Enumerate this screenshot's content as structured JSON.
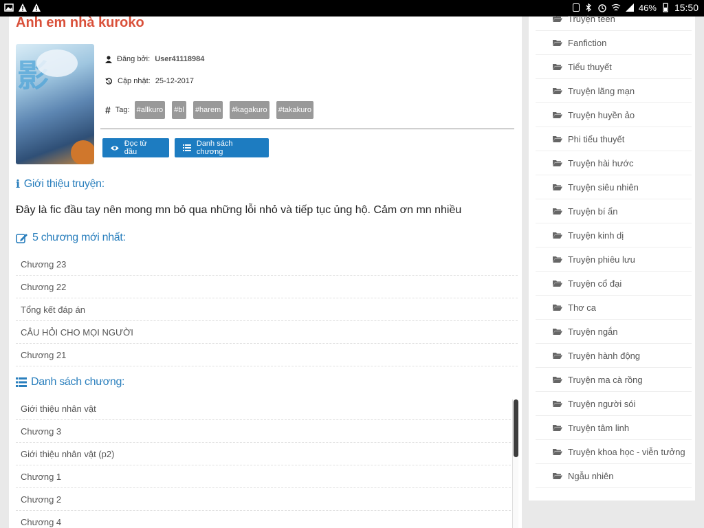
{
  "status": {
    "battery": "46%",
    "time": "15:50"
  },
  "story": {
    "title": "Anh em nhà kuroko",
    "author_label": "Đăng bởi:",
    "author": "User41118984",
    "updated_label": "Cập nhật:",
    "updated": "25-12-2017",
    "tag_label": "Tag:",
    "tags": [
      "#allkuro",
      "#bl",
      "#harem",
      "#kagakuro",
      "#takakuro"
    ]
  },
  "buttons": {
    "read": "Đọc từ đầu",
    "list": "Danh sách chương"
  },
  "sections": {
    "intro_title": "Giới thiệu truyện:",
    "intro_text": "Đây là fic đầu tay nên mong mn bỏ qua những lỗi nhỏ và tiếp tục ủng hộ. Cảm ơn mn nhiều",
    "latest_title": "5 chương mới nhất:",
    "list_title": "Danh sách chương:"
  },
  "latest_chapters": [
    "Chương 23",
    "Chương 22",
    "Tổng kết đáp án",
    "CÂU HỎI CHO MỌI NGƯỜI",
    "Chương 21"
  ],
  "all_chapters": [
    "Giới thiệu nhân vật",
    "Chương 3",
    "Giới thiệu nhân vật (p2)",
    "Chương 1",
    "Chương 2",
    "Chương 4"
  ],
  "categories": [
    "Truyện teen",
    "Fanfiction",
    "Tiểu thuyết",
    "Truyện lãng mạn",
    "Truyện huyền ảo",
    "Phi tiểu thuyết",
    "Truyện hài hước",
    "Truyện siêu nhiên",
    "Truyện bí ẩn",
    "Truyện kinh dị",
    "Truyện phiêu lưu",
    "Truyện cổ đại",
    "Thơ ca",
    "Truyện ngắn",
    "Truyện hành động",
    "Truyện ma cà rồng",
    "Truyện người sói",
    "Truyện tâm linh",
    "Truyện khoa học - viễn tưởng",
    "Ngẫu nhiên"
  ],
  "colors": {
    "title": "#d9503a",
    "accent": "#2a7fbd",
    "button": "#1d7cc1",
    "tag": "#999999"
  }
}
